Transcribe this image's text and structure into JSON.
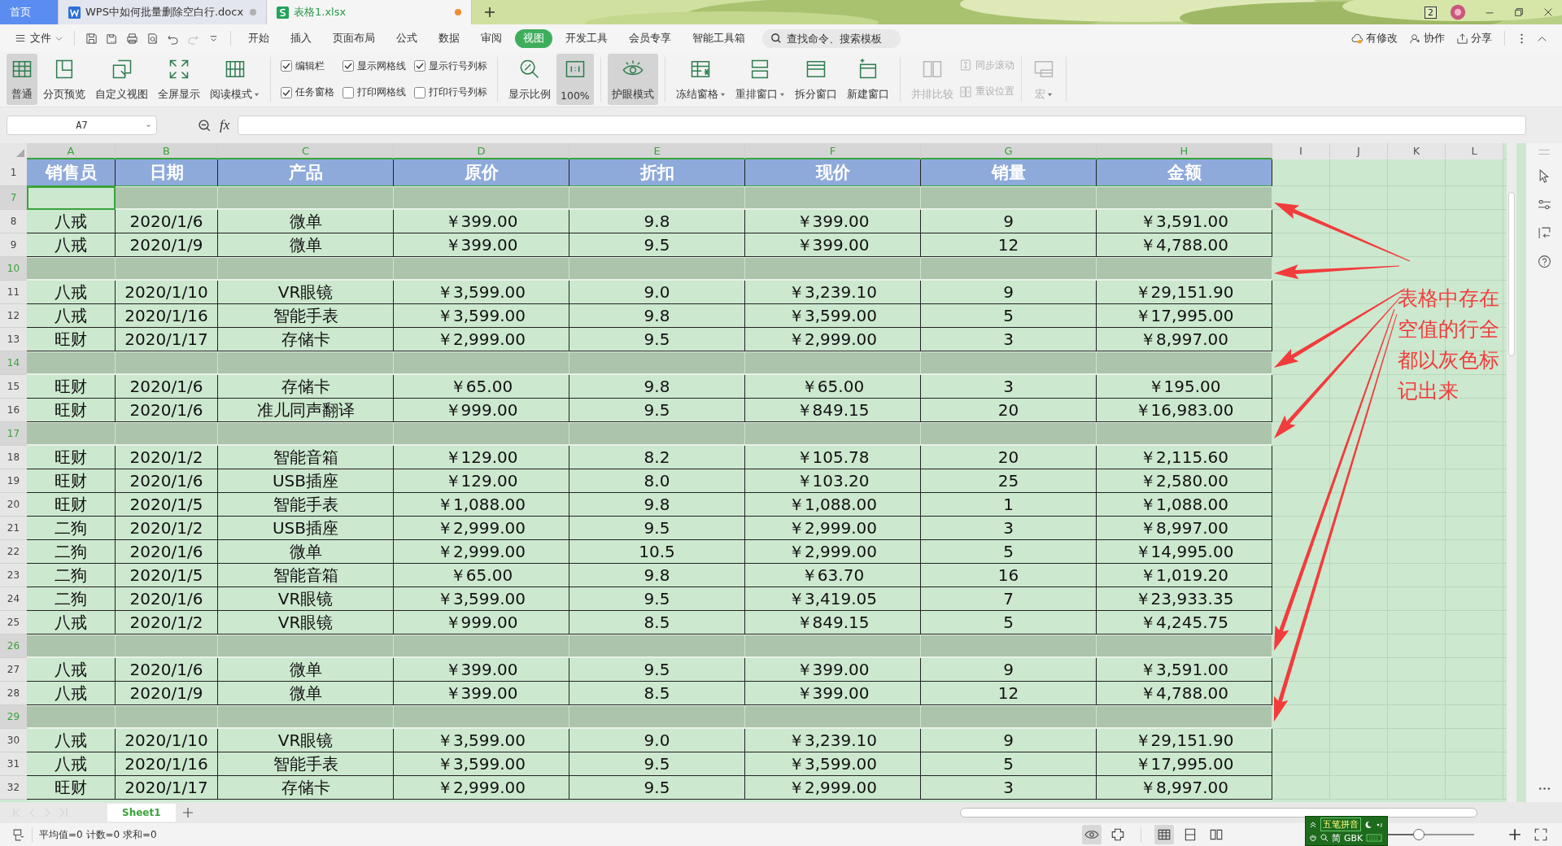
{
  "tabs": [
    {
      "label": "首页",
      "kind": "home",
      "selected": false
    },
    {
      "label": "WPS中如何批量删除空白行.docx",
      "kind": "doc",
      "selected": false,
      "modified": false
    },
    {
      "label": "表格1.xlsx",
      "kind": "sheet",
      "selected": true,
      "modified": true
    }
  ],
  "window_badge": "2",
  "menu": {
    "file": "文件",
    "tabs": [
      {
        "label": "开始",
        "selected": false
      },
      {
        "label": "插入",
        "selected": false
      },
      {
        "label": "页面布局",
        "selected": false
      },
      {
        "label": "公式",
        "selected": false
      },
      {
        "label": "数据",
        "selected": false
      },
      {
        "label": "审阅",
        "selected": false
      },
      {
        "label": "视图",
        "selected": true
      },
      {
        "label": "开发工具",
        "selected": false
      },
      {
        "label": "会员专享",
        "selected": false
      },
      {
        "label": "智能工具箱",
        "selected": false
      }
    ],
    "search": {
      "placeholder": "查找命令、搜索模板"
    },
    "actions": [
      "有修改",
      "协作",
      "分享"
    ]
  },
  "ribbon": [
    {
      "items": [
        {
          "kind": "large",
          "label": "普通",
          "selected": true,
          "disabled": false,
          "dropdown": false
        },
        {
          "kind": "large",
          "label": "分页预览",
          "selected": false,
          "disabled": false,
          "dropdown": false
        },
        {
          "kind": "large",
          "label": "自定义视图",
          "selected": false,
          "disabled": false,
          "dropdown": false
        },
        {
          "kind": "large",
          "label": "全屏显示",
          "selected": false,
          "disabled": false,
          "dropdown": false
        },
        {
          "kind": "large",
          "label": "阅读模式",
          "selected": false,
          "disabled": false,
          "dropdown": true
        }
      ]
    },
    {
      "items": [
        {
          "kind": "check",
          "label": "编辑栏",
          "checked": true
        },
        {
          "kind": "check",
          "label": "任务窗格",
          "checked": true
        },
        {
          "kind": "check",
          "label": "显示网格线",
          "checked": true
        },
        {
          "kind": "check",
          "label": "打印网格线",
          "checked": false
        },
        {
          "kind": "check",
          "label": "显示行号列标",
          "checked": true
        },
        {
          "kind": "check",
          "label": "打印行号列标",
          "checked": false
        }
      ]
    },
    {
      "items": [
        {
          "kind": "large",
          "label": "显示比例",
          "selected": false,
          "disabled": false,
          "dropdown": false
        },
        {
          "kind": "large",
          "label": "100%",
          "selected": true,
          "disabled": false,
          "dropdown": false
        }
      ]
    },
    {
      "items": [
        {
          "kind": "large",
          "label": "护眼模式",
          "selected": true,
          "disabled": false,
          "dropdown": false
        }
      ]
    },
    {
      "items": [
        {
          "kind": "large",
          "label": "冻结窗格",
          "selected": false,
          "disabled": false,
          "dropdown": true
        },
        {
          "kind": "large",
          "label": "重排窗口",
          "selected": false,
          "disabled": false,
          "dropdown": true
        },
        {
          "kind": "large",
          "label": "拆分窗口",
          "selected": false,
          "disabled": false,
          "dropdown": false
        },
        {
          "kind": "large",
          "label": "新建窗口",
          "selected": false,
          "disabled": false,
          "dropdown": false
        }
      ]
    },
    {
      "items": [
        {
          "kind": "large",
          "label": "并排比较",
          "selected": false,
          "disabled": true,
          "dropdown": false
        },
        {
          "kind": "small",
          "label": "同步滚动",
          "disabled": true
        },
        {
          "kind": "small",
          "label": "重设位置",
          "disabled": true
        }
      ]
    },
    {
      "items": [
        {
          "kind": "large",
          "label": "宏",
          "selected": false,
          "disabled": true,
          "dropdown": true
        }
      ]
    }
  ],
  "formula_bar": {
    "name_box": "A7",
    "fx": "fx"
  },
  "sheet": {
    "columns": [
      {
        "letter": "A",
        "selected": true
      },
      {
        "letter": "B",
        "selected": true
      },
      {
        "letter": "C",
        "selected": true
      },
      {
        "letter": "D",
        "selected": true
      },
      {
        "letter": "E",
        "selected": true
      },
      {
        "letter": "F",
        "selected": true
      },
      {
        "letter": "G",
        "selected": true
      },
      {
        "letter": "H",
        "selected": true
      },
      {
        "letter": "I",
        "selected": false
      },
      {
        "letter": "J",
        "selected": false
      },
      {
        "letter": "K",
        "selected": false
      },
      {
        "letter": "L",
        "selected": false
      }
    ],
    "rows": [
      {
        "num": "1",
        "kind": "header",
        "selected": false,
        "active": false,
        "cells": [
          "销售员",
          "日期",
          "产品",
          "原价",
          "折扣",
          "现价",
          "销量",
          "金额"
        ]
      },
      {
        "num": "7",
        "kind": "empty",
        "selected": true,
        "active": true
      },
      {
        "num": "8",
        "kind": "data",
        "selected": false,
        "active": false,
        "cells": [
          "八戒",
          "2020/1/6",
          "微单",
          "￥399.00",
          "9.8",
          "￥399.00",
          "9",
          "￥3,591.00"
        ]
      },
      {
        "num": "9",
        "kind": "data",
        "selected": false,
        "active": false,
        "cells": [
          "八戒",
          "2020/1/9",
          "微单",
          "￥399.00",
          "9.5",
          "￥399.00",
          "12",
          "￥4,788.00"
        ]
      },
      {
        "num": "10",
        "kind": "empty",
        "selected": true,
        "active": false
      },
      {
        "num": "11",
        "kind": "data",
        "selected": false,
        "active": false,
        "cells": [
          "八戒",
          "2020/1/10",
          "VR眼镜",
          "￥3,599.00",
          "9.0",
          "￥3,239.10",
          "9",
          "￥29,151.90"
        ]
      },
      {
        "num": "12",
        "kind": "data",
        "selected": false,
        "active": false,
        "cells": [
          "八戒",
          "2020/1/16",
          "智能手表",
          "￥3,599.00",
          "9.8",
          "￥3,599.00",
          "5",
          "￥17,995.00"
        ]
      },
      {
        "num": "13",
        "kind": "data",
        "selected": false,
        "active": false,
        "cells": [
          "旺财",
          "2020/1/17",
          "存储卡",
          "￥2,999.00",
          "9.5",
          "￥2,999.00",
          "3",
          "￥8,997.00"
        ]
      },
      {
        "num": "14",
        "kind": "empty",
        "selected": true,
        "active": false
      },
      {
        "num": "15",
        "kind": "data",
        "selected": false,
        "active": false,
        "cells": [
          "旺财",
          "2020/1/6",
          "存储卡",
          "￥65.00",
          "9.8",
          "￥65.00",
          "3",
          "￥195.00"
        ]
      },
      {
        "num": "16",
        "kind": "data",
        "selected": false,
        "active": false,
        "cells": [
          "旺财",
          "2020/1/6",
          "准儿同声翻译",
          "￥999.00",
          "9.5",
          "￥849.15",
          "20",
          "￥16,983.00"
        ]
      },
      {
        "num": "17",
        "kind": "empty",
        "selected": true,
        "active": false
      },
      {
        "num": "18",
        "kind": "data",
        "selected": false,
        "active": false,
        "cells": [
          "旺财",
          "2020/1/2",
          "智能音箱",
          "￥129.00",
          "8.2",
          "￥105.78",
          "20",
          "￥2,115.60"
        ]
      },
      {
        "num": "19",
        "kind": "data",
        "selected": false,
        "active": false,
        "cells": [
          "旺财",
          "2020/1/6",
          "USB插座",
          "￥129.00",
          "8.0",
          "￥103.20",
          "25",
          "￥2,580.00"
        ]
      },
      {
        "num": "20",
        "kind": "data",
        "selected": false,
        "active": false,
        "cells": [
          "旺财",
          "2020/1/5",
          "智能手表",
          "￥1,088.00",
          "9.8",
          "￥1,088.00",
          "1",
          "￥1,088.00"
        ]
      },
      {
        "num": "21",
        "kind": "data",
        "selected": false,
        "active": false,
        "cells": [
          "二狗",
          "2020/1/2",
          "USB插座",
          "￥2,999.00",
          "9.5",
          "￥2,999.00",
          "3",
          "￥8,997.00"
        ]
      },
      {
        "num": "22",
        "kind": "data",
        "selected": false,
        "active": false,
        "cells": [
          "二狗",
          "2020/1/6",
          "微单",
          "￥2,999.00",
          "10.5",
          "￥2,999.00",
          "5",
          "￥14,995.00"
        ]
      },
      {
        "num": "23",
        "kind": "data",
        "selected": false,
        "active": false,
        "cells": [
          "二狗",
          "2020/1/5",
          "智能音箱",
          "￥65.00",
          "9.8",
          "￥63.70",
          "16",
          "￥1,019.20"
        ]
      },
      {
        "num": "24",
        "kind": "data",
        "selected": false,
        "active": false,
        "cells": [
          "二狗",
          "2020/1/6",
          "VR眼镜",
          "￥3,599.00",
          "9.5",
          "￥3,419.05",
          "7",
          "￥23,933.35"
        ]
      },
      {
        "num": "25",
        "kind": "data",
        "selected": false,
        "active": false,
        "cells": [
          "八戒",
          "2020/1/2",
          "VR眼镜",
          "￥999.00",
          "8.5",
          "￥849.15",
          "5",
          "￥4,245.75"
        ]
      },
      {
        "num": "26",
        "kind": "empty",
        "selected": true,
        "active": false
      },
      {
        "num": "27",
        "kind": "data",
        "selected": false,
        "active": false,
        "cells": [
          "八戒",
          "2020/1/6",
          "微单",
          "￥399.00",
          "9.5",
          "￥399.00",
          "9",
          "￥3,591.00"
        ]
      },
      {
        "num": "28",
        "kind": "data",
        "selected": false,
        "active": false,
        "cells": [
          "八戒",
          "2020/1/9",
          "微单",
          "￥399.00",
          "8.5",
          "￥399.00",
          "12",
          "￥4,788.00"
        ]
      },
      {
        "num": "29",
        "kind": "empty",
        "selected": true,
        "active": false
      },
      {
        "num": "30",
        "kind": "data",
        "selected": false,
        "active": false,
        "cells": [
          "八戒",
          "2020/1/10",
          "VR眼镜",
          "￥3,599.00",
          "9.0",
          "￥3,239.10",
          "9",
          "￥29,151.90"
        ]
      },
      {
        "num": "31",
        "kind": "data",
        "selected": false,
        "active": false,
        "cells": [
          "八戒",
          "2020/1/16",
          "智能手表",
          "￥3,599.00",
          "9.5",
          "￥3,599.00",
          "5",
          "￥17,995.00"
        ]
      },
      {
        "num": "32",
        "kind": "data",
        "selected": false,
        "active": false,
        "cells": [
          "旺财",
          "2020/1/17",
          "存储卡",
          "￥2,999.00",
          "9.5",
          "￥2,999.00",
          "3",
          "￥8,997.00"
        ]
      }
    ],
    "annotation": "表格中存在空值的行全都以灰色标记出来"
  },
  "sheet_tabs": [
    {
      "label": "Sheet1",
      "selected": true
    }
  ],
  "status_bar": {
    "summary": "平均值=0 计数=0 求和=0",
    "ime": {
      "name": "五笔拼音",
      "mode": "简",
      "charset": "GBK"
    },
    "zoom": {
      "level": 0.5
    }
  }
}
